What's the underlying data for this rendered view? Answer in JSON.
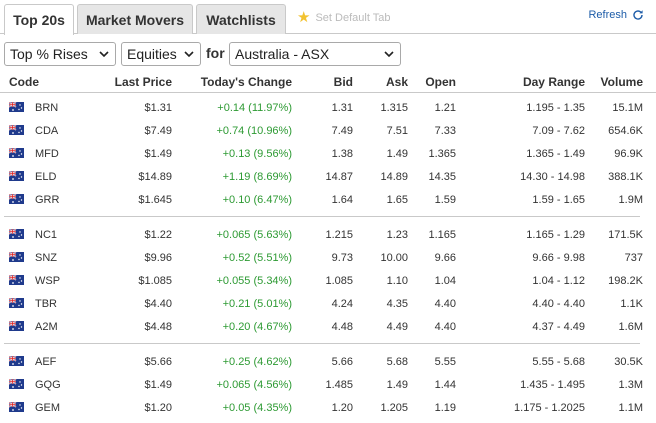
{
  "tabs": [
    {
      "label": "Top 20s",
      "active": true
    },
    {
      "label": "Market Movers",
      "active": false
    },
    {
      "label": "Watchlists",
      "active": false
    }
  ],
  "default_tab": {
    "label": "Set Default Tab",
    "icon": "star-icon"
  },
  "refresh": {
    "label": "Refresh",
    "icon": "refresh-icon"
  },
  "filters": {
    "type": "Top % Rises",
    "market": "Equities",
    "for_label": "for",
    "exchange": "Australia - ASX"
  },
  "columns": {
    "code": "Code",
    "last": "Last Price",
    "change": "Today's Change",
    "bid": "Bid",
    "ask": "Ask",
    "open": "Open",
    "range": "Day Range",
    "volume": "Volume"
  },
  "colors": {
    "positive": "#2d9a33",
    "link": "#1d5ca8",
    "star": "#f2c230"
  },
  "rows": [
    {
      "code": "BRN",
      "last": "$1.31",
      "change": "+0.14 (11.97%)",
      "bid": "1.31",
      "ask": "1.315",
      "open": "1.21",
      "range": "1.195 - 1.35",
      "volume": "15.1M"
    },
    {
      "code": "CDA",
      "last": "$7.49",
      "change": "+0.74 (10.96%)",
      "bid": "7.49",
      "ask": "7.51",
      "open": "7.33",
      "range": "7.09 - 7.62",
      "volume": "654.6K"
    },
    {
      "code": "MFD",
      "last": "$1.49",
      "change": "+0.13 (9.56%)",
      "bid": "1.38",
      "ask": "1.49",
      "open": "1.365",
      "range": "1.365 - 1.49",
      "volume": "96.9K"
    },
    {
      "code": "ELD",
      "last": "$14.89",
      "change": "+1.19 (8.69%)",
      "bid": "14.87",
      "ask": "14.89",
      "open": "14.35",
      "range": "14.30 - 14.98",
      "volume": "388.1K"
    },
    {
      "code": "GRR",
      "last": "$1.645",
      "change": "+0.10 (6.47%)",
      "bid": "1.64",
      "ask": "1.65",
      "open": "1.59",
      "range": "1.59 - 1.65",
      "volume": "1.9M"
    },
    {
      "code": "NC1",
      "last": "$1.22",
      "change": "+0.065 (5.63%)",
      "bid": "1.215",
      "ask": "1.23",
      "open": "1.165",
      "range": "1.165 - 1.29",
      "volume": "171.5K"
    },
    {
      "code": "SNZ",
      "last": "$9.96",
      "change": "+0.52 (5.51%)",
      "bid": "9.73",
      "ask": "10.00",
      "open": "9.66",
      "range": "9.66 - 9.98",
      "volume": "737"
    },
    {
      "code": "WSP",
      "last": "$1.085",
      "change": "+0.055 (5.34%)",
      "bid": "1.085",
      "ask": "1.10",
      "open": "1.04",
      "range": "1.04 - 1.12",
      "volume": "198.2K"
    },
    {
      "code": "TBR",
      "last": "$4.40",
      "change": "+0.21 (5.01%)",
      "bid": "4.24",
      "ask": "4.35",
      "open": "4.40",
      "range": "4.40 - 4.40",
      "volume": "1.1K"
    },
    {
      "code": "A2M",
      "last": "$4.48",
      "change": "+0.20 (4.67%)",
      "bid": "4.48",
      "ask": "4.49",
      "open": "4.40",
      "range": "4.37 - 4.49",
      "volume": "1.6M"
    },
    {
      "code": "AEF",
      "last": "$5.66",
      "change": "+0.25 (4.62%)",
      "bid": "5.66",
      "ask": "5.68",
      "open": "5.55",
      "range": "5.55 - 5.68",
      "volume": "30.5K"
    },
    {
      "code": "GQG",
      "last": "$1.49",
      "change": "+0.065 (4.56%)",
      "bid": "1.485",
      "ask": "1.49",
      "open": "1.44",
      "range": "1.435 - 1.495",
      "volume": "1.3M"
    },
    {
      "code": "GEM",
      "last": "$1.20",
      "change": "+0.05 (4.35%)",
      "bid": "1.20",
      "ask": "1.205",
      "open": "1.19",
      "range": "1.175 - 1.2025",
      "volume": "1.1M"
    }
  ]
}
